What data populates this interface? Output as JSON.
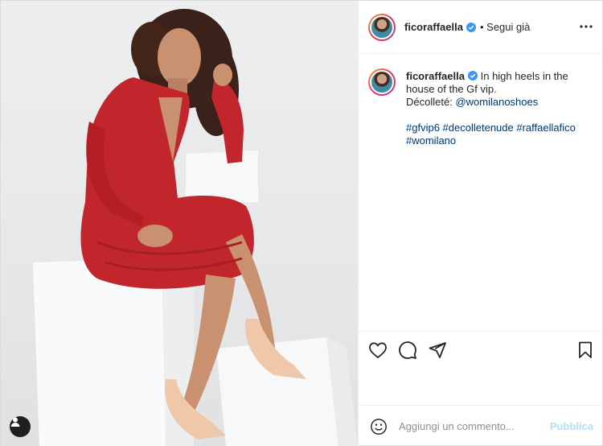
{
  "post": {
    "author": {
      "username": "ficoraffaella",
      "verified": true,
      "follow_status": "• Segui già"
    },
    "caption": {
      "username": "ficoraffaella",
      "line1": "In high heels in the house of the Gf vip.",
      "decollete_label": "Décolleté:",
      "mention": "@womilanoshoes",
      "hashtags": [
        "#gfvip6",
        "#decolletenude",
        "#raffaellafico",
        "#womilano"
      ]
    },
    "actions": {
      "like_icon": "heart-icon",
      "comment_icon": "comment-icon",
      "share_icon": "paper-plane-icon",
      "save_icon": "bookmark-icon"
    },
    "comment_box": {
      "placeholder": "Aggiungi un commento...",
      "publish_label": "Pubblica"
    },
    "photo": {
      "description_icon": "user-tag-icon"
    }
  },
  "colors": {
    "link": "#00376b",
    "verified": "#3897f0",
    "publish_disabled": "#b2dffc",
    "dress": "#c2262d"
  }
}
